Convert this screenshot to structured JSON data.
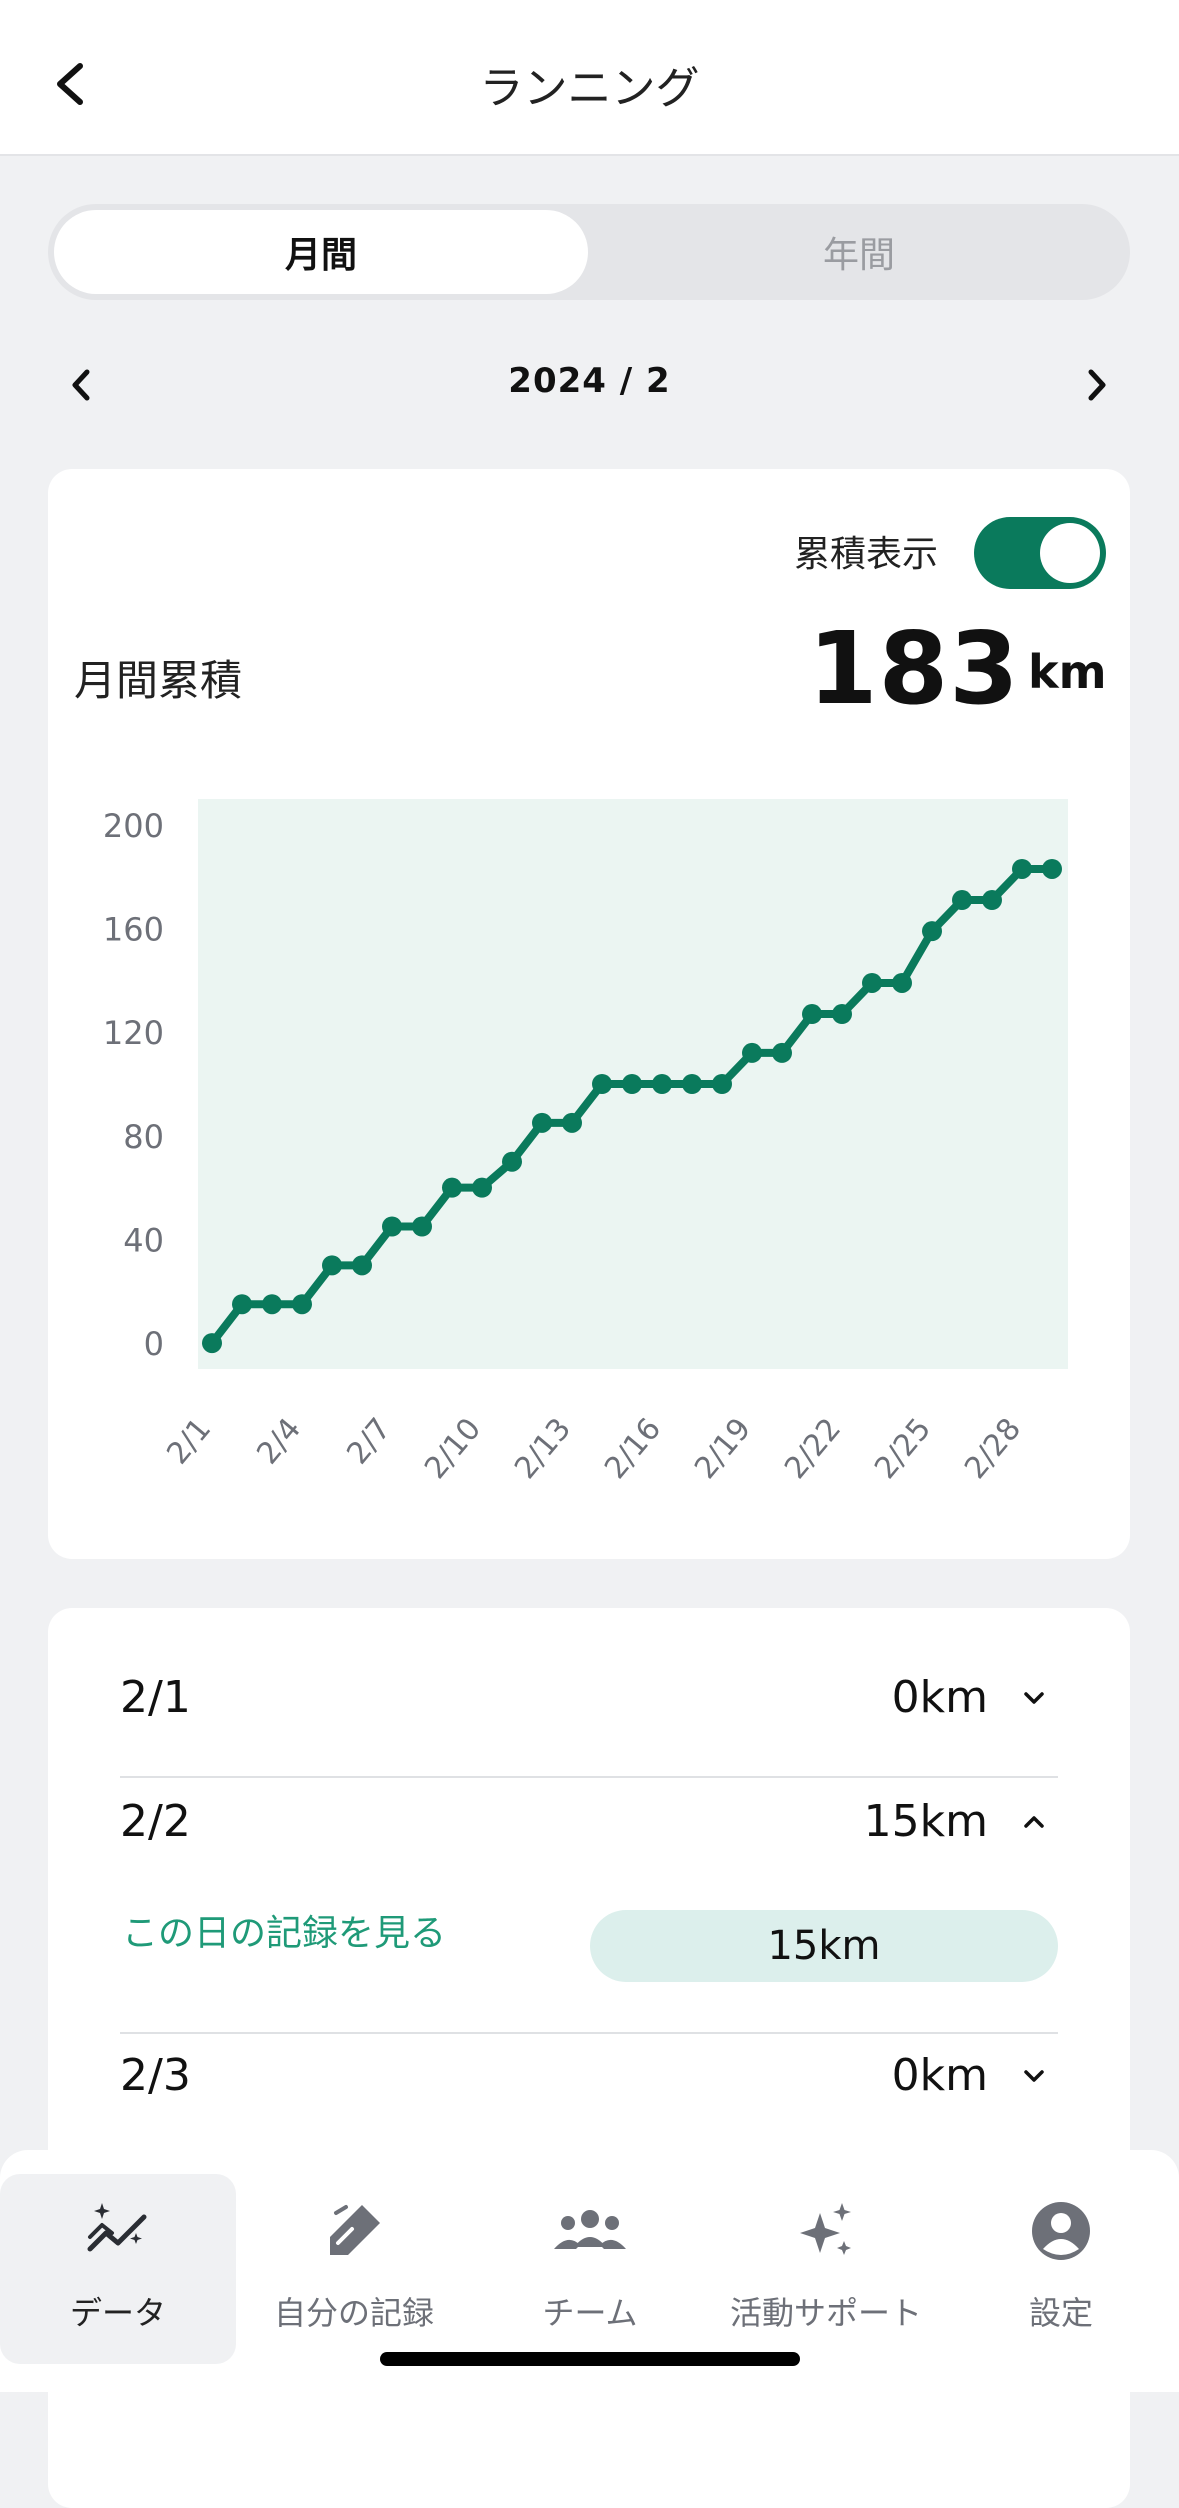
{
  "header": {
    "title": "ランニング"
  },
  "segment": {
    "monthly": "月間",
    "yearly": "年間"
  },
  "month_nav": {
    "label": "2024 / 2"
  },
  "summary": {
    "toggle_label": "累積表示",
    "toggle_on": true,
    "monthly_label": "月間累積",
    "monthly_value": "183",
    "monthly_unit": "km"
  },
  "chart_data": {
    "type": "line",
    "title": "",
    "xlabel": "",
    "ylabel": "",
    "ylim": [
      -10,
      210
    ],
    "yticks": [
      0,
      40,
      80,
      120,
      160,
      200
    ],
    "x": [
      "2/1",
      "2/2",
      "2/3",
      "2/4",
      "2/5",
      "2/6",
      "2/7",
      "2/8",
      "2/9",
      "2/10",
      "2/11",
      "2/12",
      "2/13",
      "2/14",
      "2/15",
      "2/16",
      "2/17",
      "2/18",
      "2/19",
      "2/20",
      "2/21",
      "2/22",
      "2/23",
      "2/24",
      "2/25",
      "2/26",
      "2/27",
      "2/28",
      "2/29"
    ],
    "xtick_labels": [
      "2/1",
      "2/4",
      "2/7",
      "2/10",
      "2/13",
      "2/16",
      "2/19",
      "2/22",
      "2/25",
      "2/28"
    ],
    "series": [
      {
        "color": "#0a7a5c",
        "values": [
          0,
          15,
          15,
          15,
          30,
          30,
          45,
          45,
          60,
          60,
          70,
          85,
          85,
          100,
          100,
          100,
          100,
          100,
          112,
          112,
          127,
          127,
          139,
          139,
          159,
          171,
          171,
          183,
          183
        ]
      }
    ],
    "fill_color": "#ebf5f2",
    "grid": false
  },
  "records": [
    {
      "date": "2/1",
      "value": "0km",
      "expanded": false
    },
    {
      "date": "2/2",
      "value": "15km",
      "expanded": true,
      "link": "この日の記録を見る",
      "detail": "15km"
    },
    {
      "date": "2/3",
      "value": "0km",
      "expanded": false
    }
  ],
  "tabs": [
    {
      "label": "データ",
      "icon": "chart-sparkle-icon",
      "active": true
    },
    {
      "label": "自分の記録",
      "icon": "pencil-icon",
      "active": false
    },
    {
      "label": "チーム",
      "icon": "group-icon",
      "active": false
    },
    {
      "label": "活動サポート",
      "icon": "sparkles-icon",
      "active": false
    },
    {
      "label": "設定",
      "icon": "account-icon",
      "active": false
    }
  ],
  "colors": {
    "accent": "#0a7a5c",
    "link": "#1f9a78",
    "pill": "#dcefec"
  }
}
